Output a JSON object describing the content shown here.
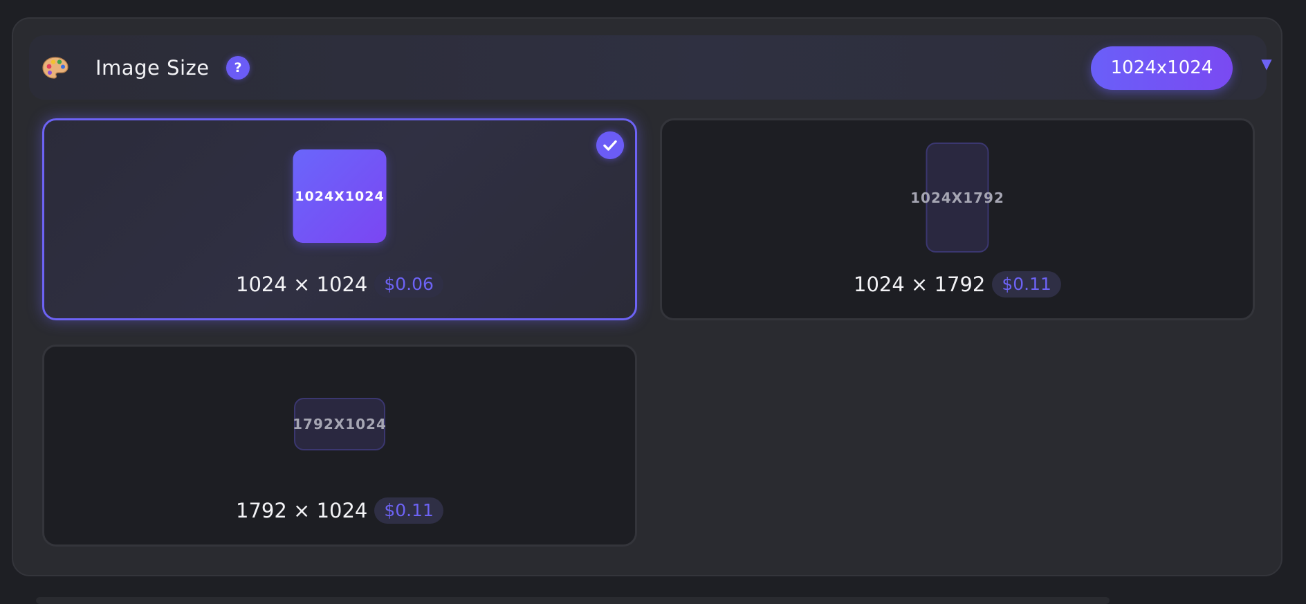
{
  "header": {
    "icon": "palette-icon",
    "title": "Image Size",
    "help_label": "?",
    "selected_value": "1024x1024",
    "dropdown_icon": "triangle-down-icon",
    "dropdown_glyph": "▼"
  },
  "options": [
    {
      "preview_label": "1024X1024",
      "dimensions": "1024 × 1024",
      "price": "$0.06",
      "selected": true
    },
    {
      "preview_label": "1024X1792",
      "dimensions": "1024 × 1792",
      "price": "$0.11",
      "selected": false
    },
    {
      "preview_label": "1792X1024",
      "dimensions": "1792 × 1024",
      "price": "$0.11",
      "selected": false
    }
  ],
  "colors": {
    "accent": "#6d63f5",
    "accent_gradient_end": "#7b46f2",
    "panel_bg": "#2a2b30",
    "page_bg": "#1e1f24",
    "card_bg": "#1d1e23"
  }
}
